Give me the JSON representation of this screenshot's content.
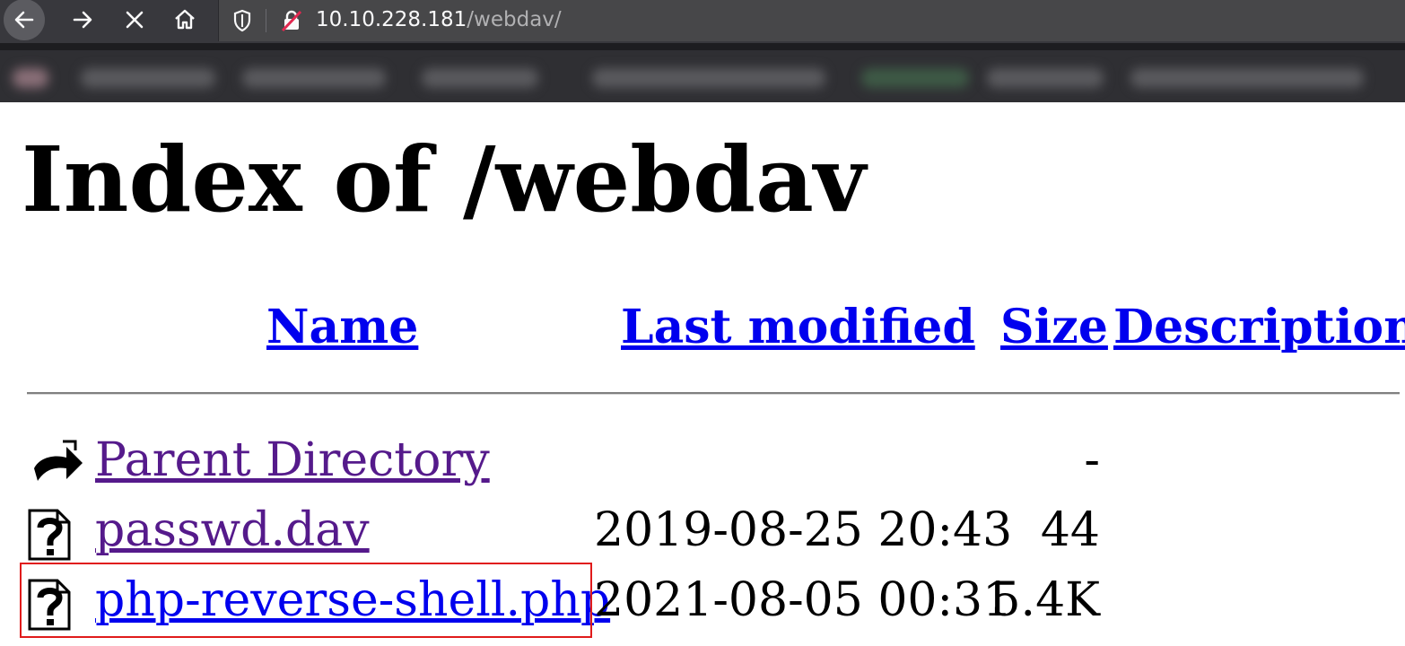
{
  "browser": {
    "url_host": "10.10.228.181",
    "url_path": "/webdav/"
  },
  "page": {
    "title": "Index of /webdav",
    "columns": {
      "name": "Name",
      "last_modified": "Last modified",
      "size": "Size",
      "description": "Description"
    },
    "rows": [
      {
        "name": "Parent Directory",
        "last_modified": "",
        "size": "-",
        "description": "",
        "icon": "back-arrow-icon",
        "visited": true
      },
      {
        "name": "passwd.dav",
        "last_modified": "2019-08-25 20:43",
        "size": "44",
        "description": "",
        "icon": "unknown-file-icon",
        "visited": true
      },
      {
        "name": "php-reverse-shell.php",
        "last_modified": "2021-08-05 00:31",
        "size": "5.4K",
        "description": "",
        "icon": "unknown-file-icon",
        "visited": false,
        "highlighted": true
      }
    ]
  },
  "colors": {
    "link": "#0000ee",
    "visited_link": "#551a8b",
    "highlight": "#e01b1b"
  }
}
